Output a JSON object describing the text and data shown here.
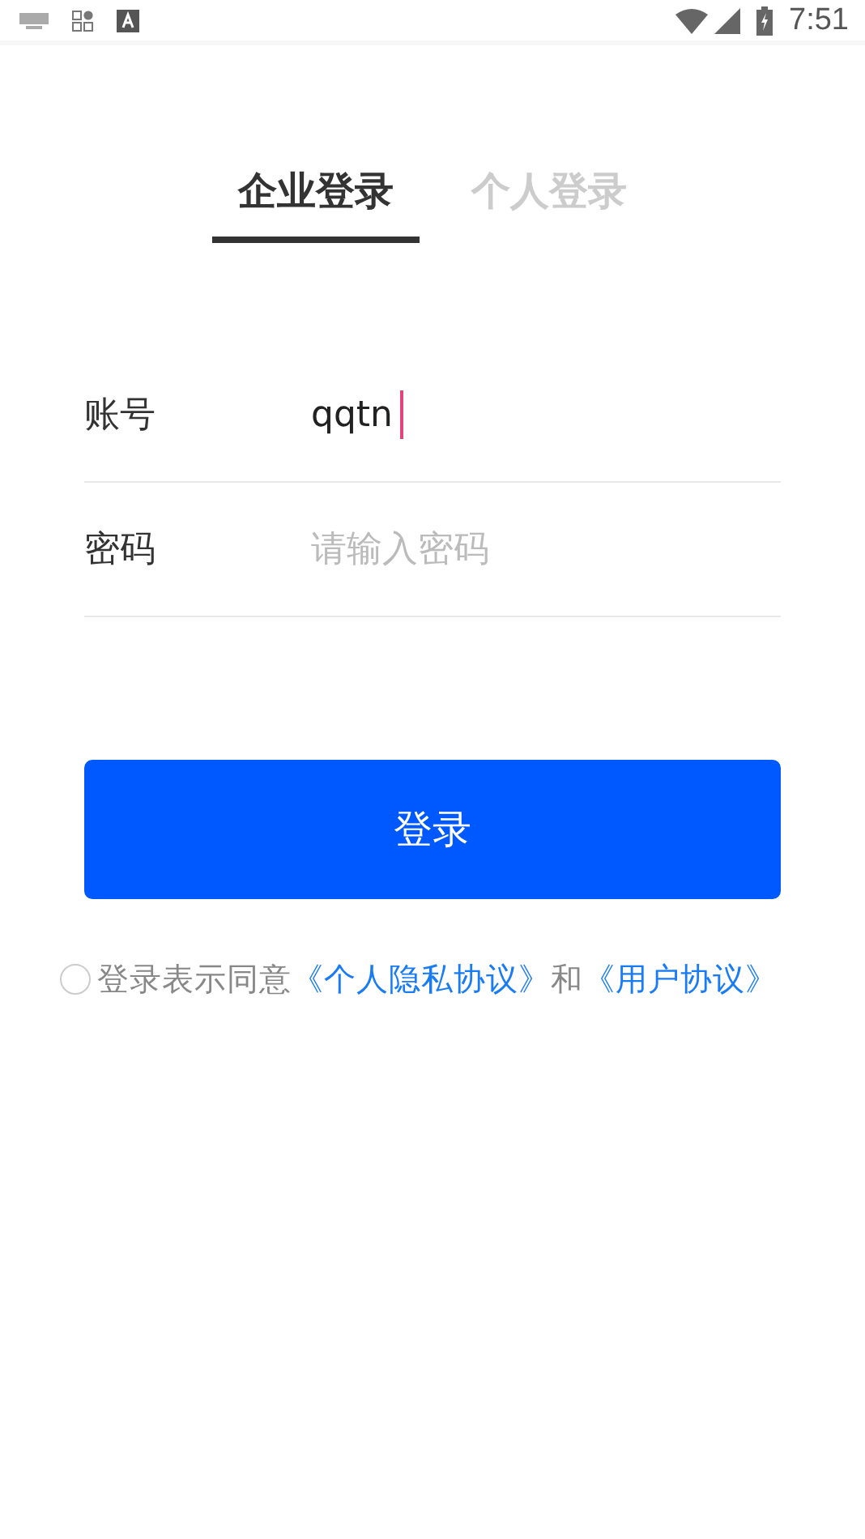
{
  "status_bar": {
    "time": "7:51"
  },
  "tabs": [
    {
      "label": "企业登录",
      "selected": true
    },
    {
      "label": "个人登录",
      "selected": false
    }
  ],
  "fields": [
    {
      "label": "账号",
      "value": "qqtn",
      "focused": true
    },
    {
      "label": "密码",
      "placeholder": "请输入密码",
      "focused": false
    }
  ],
  "login_button": "登录",
  "agreement": {
    "checked": false,
    "prefix": "登录表示同意",
    "link_1": "《个人隐私协议》",
    "middle": "和",
    "link_2": "《用户协议》"
  }
}
